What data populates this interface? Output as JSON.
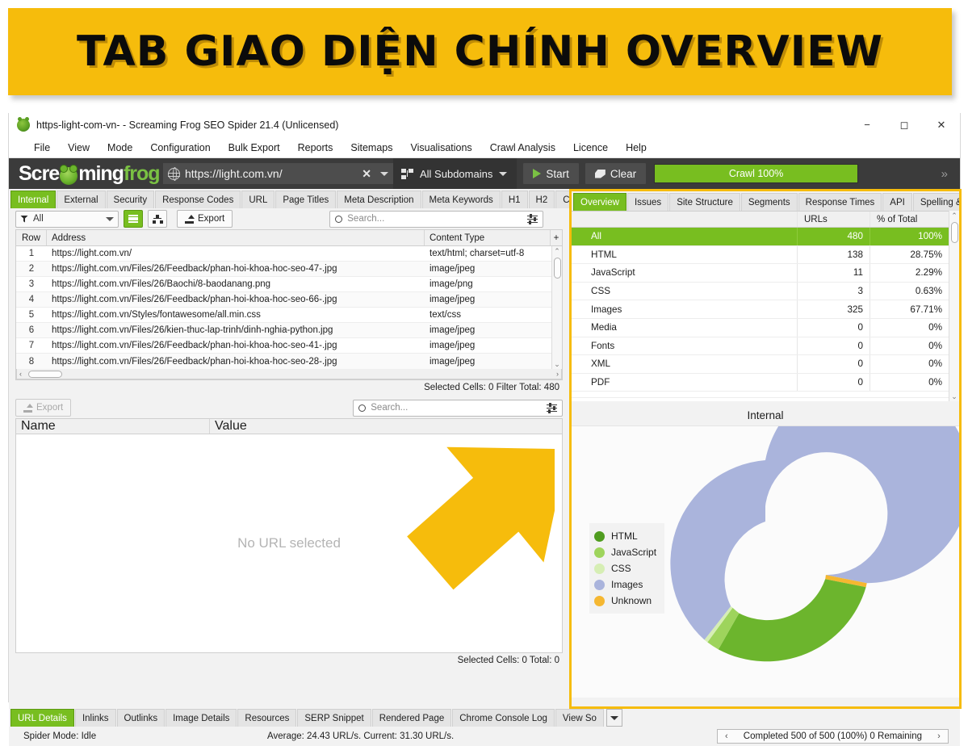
{
  "banner": {
    "text": "TAB GIAO DIỆN CHÍNH OVERVIEW"
  },
  "window": {
    "title": "https-light-com-vn- - Screaming Frog SEO Spider 21.4 (Unlicensed)",
    "minimize": "−",
    "maximize": "◻",
    "close": "✕"
  },
  "menubar": {
    "items": [
      "File",
      "View",
      "Mode",
      "Configuration",
      "Bulk Export",
      "Reports",
      "Sitemaps",
      "Visualisations",
      "Crawl Analysis",
      "Licence",
      "Help"
    ]
  },
  "toolbar": {
    "logo_part1": "Scre",
    "logo_part2": "ming",
    "logo_part3": "frog",
    "url_value": "https://light.com.vn/",
    "url_clear": "✕",
    "subdomain_label": "All Subdomains",
    "start_label": "Start",
    "clear_label": "Clear",
    "crawl_progress_label": "Crawl 100%",
    "overflow_label": "»"
  },
  "left": {
    "tabs": [
      {
        "label": "Internal",
        "active": true
      },
      {
        "label": "External",
        "active": false
      },
      {
        "label": "Security",
        "active": false
      },
      {
        "label": "Response Codes",
        "active": false
      },
      {
        "label": "URL",
        "active": false
      },
      {
        "label": "Page Titles",
        "active": false
      },
      {
        "label": "Meta Description",
        "active": false
      },
      {
        "label": "Meta Keywords",
        "active": false
      },
      {
        "label": "H1",
        "active": false
      },
      {
        "label": "H2",
        "active": false
      },
      {
        "label": "Content",
        "active": false
      }
    ],
    "filter_value": "All",
    "export_label": "Export",
    "search_placeholder": "Search...",
    "columns": [
      "Row",
      "Address",
      "Content Type"
    ],
    "column_add": "+",
    "rows": [
      {
        "row": "1",
        "address": "https://light.com.vn/",
        "content_type": "text/html; charset=utf-8"
      },
      {
        "row": "2",
        "address": "https://light.com.vn/Files/26/Feedback/phan-hoi-khoa-hoc-seo-47-.jpg",
        "content_type": "image/jpeg"
      },
      {
        "row": "3",
        "address": "https://light.com.vn/Files/26/Baochi/8-baodanang.png",
        "content_type": "image/png"
      },
      {
        "row": "4",
        "address": "https://light.com.vn/Files/26/Feedback/phan-hoi-khoa-hoc-seo-66-.jpg",
        "content_type": "image/jpeg"
      },
      {
        "row": "5",
        "address": "https://light.com.vn/Styles/fontawesome/all.min.css",
        "content_type": "text/css"
      },
      {
        "row": "6",
        "address": "https://light.com.vn/Files/26/kien-thuc-lap-trinh/dinh-nghia-python.jpg",
        "content_type": "image/jpeg"
      },
      {
        "row": "7",
        "address": "https://light.com.vn/Files/26/Feedback/phan-hoi-khoa-hoc-seo-41-.jpg",
        "content_type": "image/jpeg"
      },
      {
        "row": "8",
        "address": "https://light.com.vn/Files/26/Feedback/phan-hoi-khoa-hoc-seo-28-.jpg",
        "content_type": "image/jpeg"
      }
    ],
    "status_upper": "Selected Cells: 0  Filter Total: 480",
    "detail_export_label": "Export",
    "detail_search_placeholder": "Search...",
    "detail_columns": [
      "Name",
      "Value"
    ],
    "detail_empty_text": "No URL selected",
    "status_lower": "Selected Cells: 0  Total: 0"
  },
  "right": {
    "tabs": [
      {
        "label": "Overview",
        "active": true
      },
      {
        "label": "Issues",
        "active": false
      },
      {
        "label": "Site Structure",
        "active": false
      },
      {
        "label": "Segments",
        "active": false
      },
      {
        "label": "Response Times",
        "active": false
      },
      {
        "label": "API",
        "active": false
      },
      {
        "label": "Spelling & G",
        "active": false
      }
    ],
    "columns": [
      "",
      "URLs",
      "% of Total"
    ],
    "rows": [
      {
        "name": "All",
        "urls": "480",
        "pct": "100%",
        "selected": true
      },
      {
        "name": "HTML",
        "urls": "138",
        "pct": "28.75%",
        "selected": false
      },
      {
        "name": "JavaScript",
        "urls": "11",
        "pct": "2.29%",
        "selected": false
      },
      {
        "name": "CSS",
        "urls": "3",
        "pct": "0.63%",
        "selected": false
      },
      {
        "name": "Images",
        "urls": "325",
        "pct": "67.71%",
        "selected": false
      },
      {
        "name": "Media",
        "urls": "0",
        "pct": "0%",
        "selected": false
      },
      {
        "name": "Fonts",
        "urls": "0",
        "pct": "0%",
        "selected": false
      },
      {
        "name": "XML",
        "urls": "0",
        "pct": "0%",
        "selected": false
      },
      {
        "name": "PDF",
        "urls": "0",
        "pct": "0%",
        "selected": false
      }
    ],
    "chart_title": "Internal"
  },
  "chart_data": {
    "type": "pie",
    "title": "Internal",
    "labels": [
      "HTML",
      "JavaScript",
      "CSS",
      "Images",
      "Unknown"
    ],
    "values": [
      138,
      11,
      3,
      325,
      3
    ],
    "percents": [
      28.75,
      2.29,
      0.63,
      67.71,
      0.62
    ],
    "colors": [
      "#6cb52d",
      "#9ed45c",
      "#d6eeb4",
      "#aab4dc",
      "#f5b731"
    ],
    "legend_position": "left",
    "donut": true,
    "total": 480
  },
  "bottom": {
    "tabs": [
      {
        "label": "URL Details",
        "active": true
      },
      {
        "label": "Inlinks",
        "active": false
      },
      {
        "label": "Outlinks",
        "active": false
      },
      {
        "label": "Image Details",
        "active": false
      },
      {
        "label": "Resources",
        "active": false
      },
      {
        "label": "SERP Snippet",
        "active": false
      },
      {
        "label": "Rendered Page",
        "active": false
      },
      {
        "label": "Chrome Console Log",
        "active": false
      },
      {
        "label": "View So",
        "active": false
      }
    ],
    "spider_mode": "Spider Mode: Idle",
    "speed": "Average: 24.43 URL/s. Current: 31.30 URL/s.",
    "crawl_prev": "‹",
    "crawl_status": "Completed 500 of 500 (100%) 0 Remaining",
    "crawl_next": "›"
  },
  "colors": {
    "accent_green": "#78be20",
    "banner_yellow": "#f6bc0c",
    "toolbar_dark": "#3b3b3b"
  }
}
